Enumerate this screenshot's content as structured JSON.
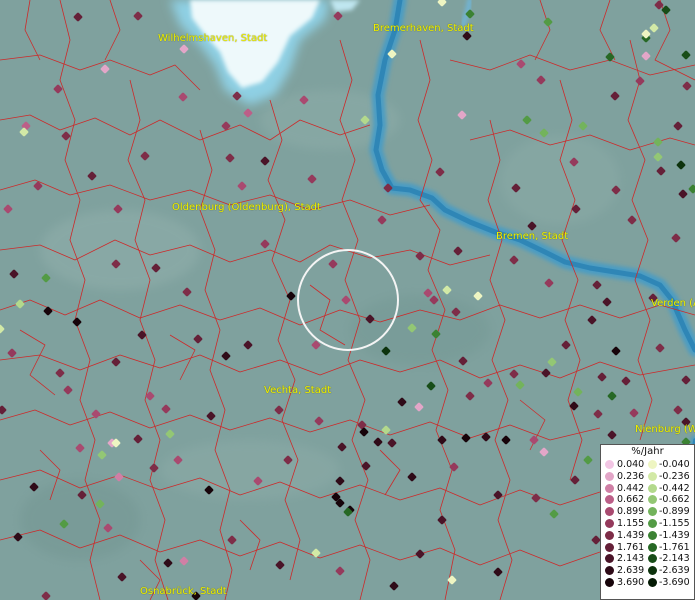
{
  "map": {
    "cities": [
      {
        "name": "Wilhelmshaven, Stadt"
      },
      {
        "name": "Bremerhaven, Stadt"
      },
      {
        "name": "Oldenburg (Oldenburg), Stadt"
      },
      {
        "name": "Bremen, Stadt"
      },
      {
        "name": "Verden (A"
      },
      {
        "name": "Vechta, Stadt"
      },
      {
        "name": "Nienburg (W"
      },
      {
        "name": "Osnabrück, Stadt"
      }
    ],
    "colors": {
      "land": "#7fa19e",
      "water": "#4a9cc4",
      "borders": "#cc2a2a",
      "labels": "#f2f200"
    }
  },
  "legend": {
    "title": "%/Jahr",
    "positive": [
      {
        "label": "0.040",
        "color": "#f2c6e4"
      },
      {
        "label": "0.236",
        "color": "#e3a6c8"
      },
      {
        "label": "0.442",
        "color": "#d07fa5"
      },
      {
        "label": "0.662",
        "color": "#bc5f88"
      },
      {
        "label": "0.899",
        "color": "#a94a70"
      },
      {
        "label": "1.155",
        "color": "#953a5c"
      },
      {
        "label": "1.439",
        "color": "#7e2d48"
      },
      {
        "label": "1.761",
        "color": "#652038"
      },
      {
        "label": "2.143",
        "color": "#4a1428"
      },
      {
        "label": "2.639",
        "color": "#2f0b18"
      },
      {
        "label": "3.690",
        "color": "#17040a"
      }
    ],
    "negative": [
      {
        "label": "-0.040",
        "color": "#eef5c2"
      },
      {
        "label": "-0.236",
        "color": "#d2e9a6"
      },
      {
        "label": "-0.442",
        "color": "#b3d98c"
      },
      {
        "label": "-0.662",
        "color": "#93c774"
      },
      {
        "label": "-0.899",
        "color": "#73b35c"
      },
      {
        "label": "-1.155",
        "color": "#539b45"
      },
      {
        "label": "-1.439",
        "color": "#3b8233"
      },
      {
        "label": "-1.761",
        "color": "#276825"
      },
      {
        "label": "-2.143",
        "color": "#184d18"
      },
      {
        "label": "-2.639",
        "color": "#0d330d"
      },
      {
        "label": "-3.690",
        "color": "#041a04"
      }
    ]
  }
}
